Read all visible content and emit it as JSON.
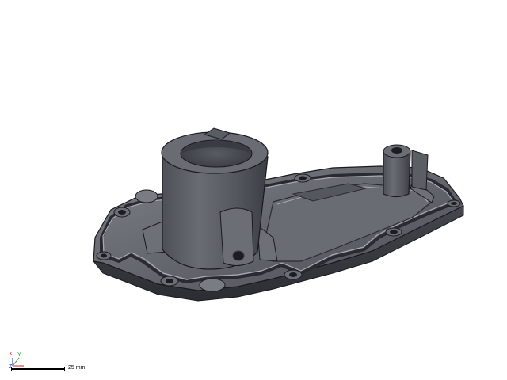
{
  "viewport": {
    "background": "#ffffff",
    "model_color": "#5c5e66",
    "model_highlight": "#8a8c94",
    "model_edge": "#1a1a1e"
  },
  "triad": {
    "x_label": "X",
    "y_label": "Y",
    "z_label": "Z",
    "x_color": "#d02020",
    "y_color": "#20a020",
    "z_color": "#2030c0"
  },
  "scale_bar": {
    "label": "25 mm"
  }
}
